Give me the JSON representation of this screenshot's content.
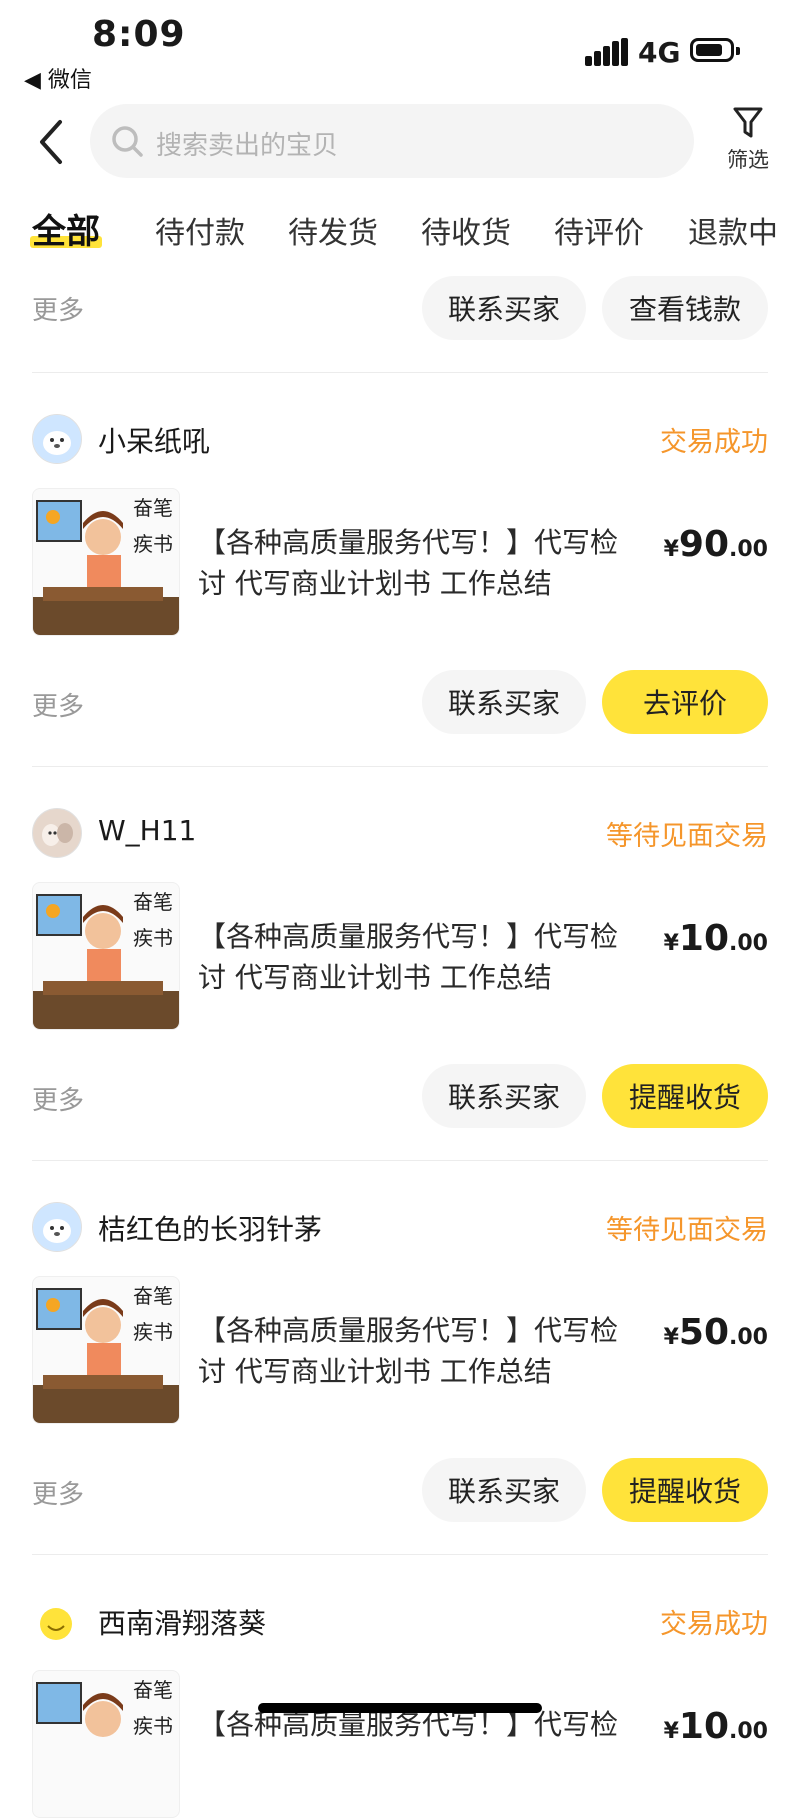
{
  "status_bar": {
    "time": "8:09",
    "back_app": "◀ 微信",
    "network": "4G"
  },
  "search": {
    "placeholder": "搜索卖出的宝贝"
  },
  "filter": {
    "label": "筛选"
  },
  "tabs": [
    {
      "label": "全部",
      "active": true
    },
    {
      "label": "待付款"
    },
    {
      "label": "待发货"
    },
    {
      "label": "待收货"
    },
    {
      "label": "待评价"
    },
    {
      "label": "退款中"
    }
  ],
  "top_partial": {
    "more": "更多",
    "buttons": [
      "联系买家",
      "查看钱款"
    ]
  },
  "orders": [
    {
      "buyer": "小呆纸吼",
      "status": "交易成功",
      "title": "【各种高质量服务代写！】代写检讨 代写商业计划书 工作总结",
      "price_yen": "¥",
      "price_int": "90",
      "price_dec": ".00",
      "more": "更多",
      "btn1": "联系买家",
      "btn2": "去评价",
      "thumb_text": [
        "奋笔",
        "疾书"
      ]
    },
    {
      "buyer": "W_H11",
      "status": "等待见面交易",
      "title": "【各种高质量服务代写！】代写检讨 代写商业计划书 工作总结",
      "price_yen": "¥",
      "price_int": "10",
      "price_dec": ".00",
      "more": "更多",
      "btn1": "联系买家",
      "btn2": "提醒收货",
      "thumb_text": [
        "奋笔",
        "疾书"
      ]
    },
    {
      "buyer": "桔红色的长羽针茅",
      "status": "等待见面交易",
      "title": "【各种高质量服务代写！】代写检讨 代写商业计划书 工作总结",
      "price_yen": "¥",
      "price_int": "50",
      "price_dec": ".00",
      "more": "更多",
      "btn1": "联系买家",
      "btn2": "提醒收货",
      "thumb_text": [
        "奋笔",
        "疾书"
      ]
    },
    {
      "buyer": "西南滑翔落葵",
      "status": "交易成功",
      "title": "【各种高质量服务代写！】代写检",
      "price_yen": "¥",
      "price_int": "10",
      "price_dec": ".00",
      "thumb_text": [
        "奋笔",
        "疾书"
      ]
    }
  ],
  "colors": {
    "accent_yellow": "#ffe33a",
    "status_orange": "#f5962b"
  }
}
